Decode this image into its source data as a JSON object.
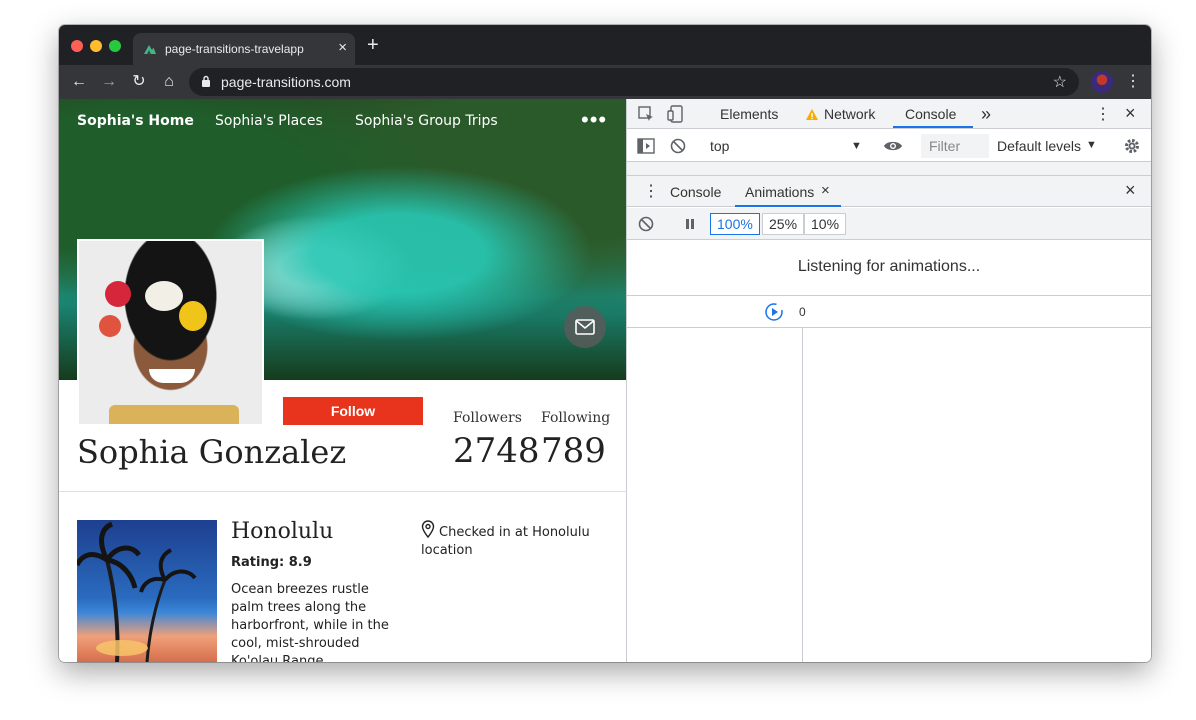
{
  "browser": {
    "tab_title": "page-transitions-travelapp",
    "tab_close": "×",
    "new_tab": "+",
    "url": "page-transitions.com",
    "back": "←",
    "forward": "→",
    "reload": "↻",
    "home": "⌂",
    "star": "☆",
    "menu": "⋮"
  },
  "site": {
    "nav": [
      "Sophia's Home",
      "Sophia's Places",
      "Sophia's Group Trips"
    ],
    "more": "•••",
    "follow_label": "Follow",
    "name": "Sophia Gonzalez",
    "followers_label": "Followers",
    "followers_value": "2748",
    "following_label": "Following",
    "following_value": "789",
    "trip": {
      "title": "Honolulu",
      "rating": "Rating: 8.9",
      "description": "Ocean breezes rustle palm trees along the harborfront, while in the cool, mist-shrouded Ko'olau Range",
      "checkin": "Checked in at Honolulu location"
    }
  },
  "devtools": {
    "tabs": [
      "Elements",
      "Network",
      "Console"
    ],
    "more_tabs": "»",
    "context": "top",
    "filter_placeholder": "Filter",
    "levels": "Default levels",
    "drawer_tabs": [
      "Console",
      "Animations"
    ],
    "drawer_close": "×",
    "speeds": [
      "100%",
      "25%",
      "10%"
    ],
    "listening": "Listening for animations...",
    "timeline_zero": "0"
  },
  "colors": {
    "follow": "#e8341c",
    "devtools_accent": "#1a73e8",
    "warning": "#f9ab00"
  }
}
